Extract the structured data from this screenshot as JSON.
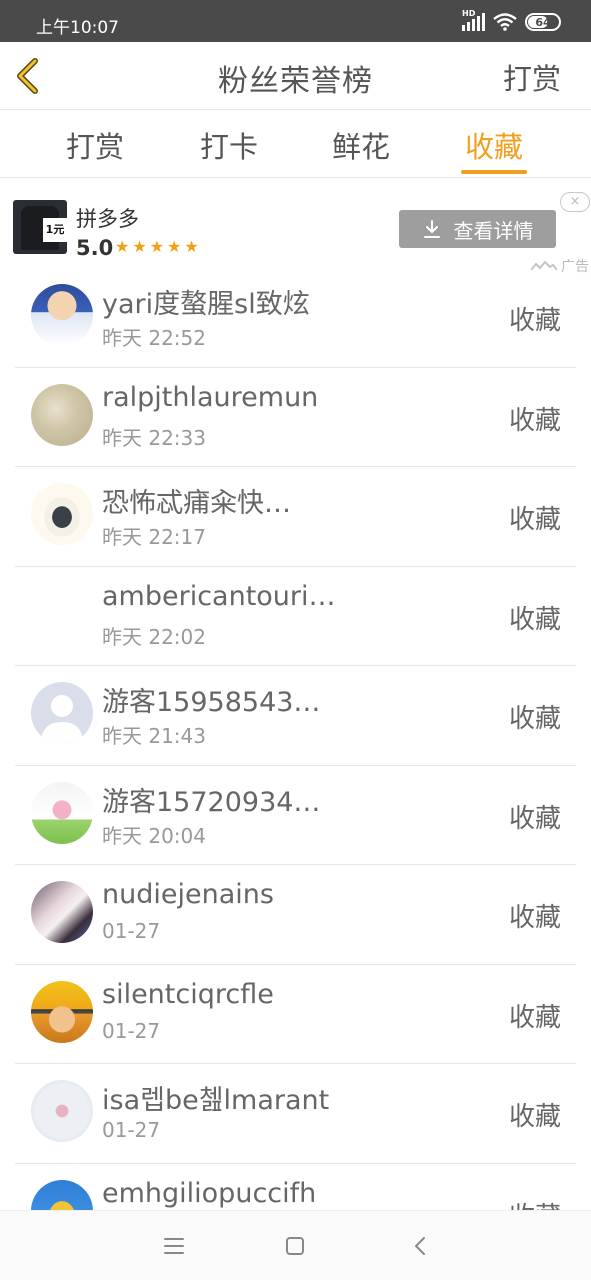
{
  "status_bar": {
    "time": "上午10:07",
    "network": "HD",
    "battery": "64"
  },
  "header": {
    "back_icon": "chevron-left-icon",
    "title": "粉丝荣誉榜",
    "action": "打赏"
  },
  "tabs": [
    {
      "label": "打赏",
      "active": false
    },
    {
      "label": "打卡",
      "active": false
    },
    {
      "label": "鲜花",
      "active": false
    },
    {
      "label": "收藏",
      "active": true
    }
  ],
  "accent_color": "#f0a020",
  "ad": {
    "thumb_badge": "1元",
    "name": "拼多多",
    "rating": "5.0",
    "stars": "★★★★★",
    "button_label": "查看详情",
    "close_label": "×",
    "label": "广告"
  },
  "list": [
    {
      "name": "yari度螯腥sl致炫",
      "time": "昨天 22:52",
      "action": "收藏",
      "avatar": "anime-boy"
    },
    {
      "name": "ralpjthlauremun",
      "time": "昨天 22:33",
      "action": "收藏",
      "avatar": "sketch"
    },
    {
      "name": "恐怖忒痡籴快…",
      "time": "昨天 22:17",
      "action": "收藏",
      "avatar": "penguin"
    },
    {
      "name": "ambericantouri…",
      "time": "昨天 22:02",
      "action": "收藏",
      "avatar": "none"
    },
    {
      "name": "游客15958543…",
      "time": "昨天 21:43",
      "action": "收藏",
      "avatar": "default"
    },
    {
      "name": "游客15720934…",
      "time": "昨天 20:04",
      "action": "收藏",
      "avatar": "bunny-girl"
    },
    {
      "name": "nudiejenains",
      "time": "01-27",
      "action": "收藏",
      "avatar": "dark-girl"
    },
    {
      "name": "silentciqrcfle",
      "time": "01-27",
      "action": "收藏",
      "avatar": "ninja"
    },
    {
      "name": "isa렙be쳂lmarant",
      "time": "01-27",
      "action": "收藏",
      "avatar": "pink-figure"
    },
    {
      "name": "emhgiliopuccifh",
      "time": "",
      "action": "收藏",
      "avatar": "yellow-bird"
    }
  ],
  "nav_bar": {
    "menu_icon": "menu-icon",
    "home_icon": "home-square-icon",
    "back_icon": "back-triangle-icon"
  }
}
